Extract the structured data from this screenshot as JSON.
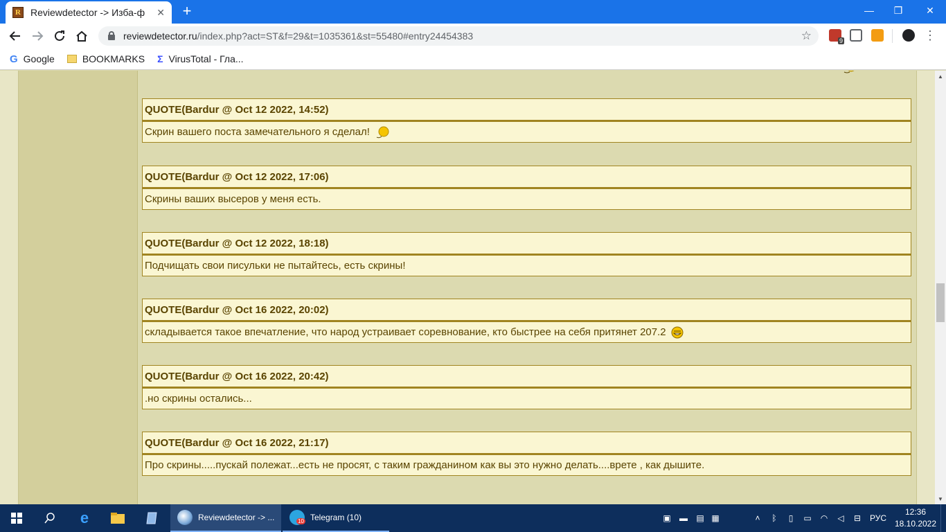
{
  "browser": {
    "tab_title": "Reviewdetector -> Изба-ф",
    "favicon_letter": "R",
    "url_host": "reviewdetector.ru",
    "url_path": "/index.php?act=ST&f=29&t=1035361&st=55480#entry24454383",
    "ext_badge_count": "9"
  },
  "bookmarks": [
    {
      "label": "Google"
    },
    {
      "label": "BOOKMARKS"
    },
    {
      "label": "VirusTotal - Гла..."
    }
  ],
  "quotes": [
    {
      "header": "QUOTE(Bardur @ Oct 12 2022, 14:52)",
      "text": "Скрин вашего поста замечательного я сделал!",
      "smiley": true
    },
    {
      "header": "QUOTE(Bardur @ Oct 12 2022, 17:06)",
      "text": "Скрины ваших высеров у меня есть.",
      "smiley": false
    },
    {
      "header": "QUOTE(Bardur @ Oct 12 2022, 18:18)",
      "text": "Подчищать свои писульки не пытайтесь, есть скрины!",
      "smiley": false
    },
    {
      "header": "QUOTE(Bardur @ Oct 16 2022, 20:02)",
      "text": "складывается такое впечатление, что народ устраивает соревнование, кто быстрее на себя притянет 207.2",
      "smiley": true
    },
    {
      "header": "QUOTE(Bardur @ Oct 16 2022, 20:42)",
      "text": ".но скрины остались...",
      "smiley": false
    },
    {
      "header": "QUOTE(Bardur @ Oct 16 2022, 21:17)",
      "text": "Про скрины.....пускай полежат...есть не просят, с таким гражданином как вы это нужно делать....врете , как дышите.",
      "smiley": false
    }
  ],
  "taskbar": {
    "apps": [
      {
        "label": "Reviewdetector -> ..."
      },
      {
        "label": "Telegram (10)",
        "badge": "10"
      }
    ],
    "language": "РУС",
    "time": "12:36",
    "date": "18.10.2022"
  },
  "colors": {
    "chrome_blue": "#1a73e8",
    "page_bg": "#dcdab0",
    "quote_bg": "#faf6d2",
    "quote_border": "#a08420",
    "quote_text": "#5a4400",
    "taskbar_bg": "#0d2e5c"
  }
}
